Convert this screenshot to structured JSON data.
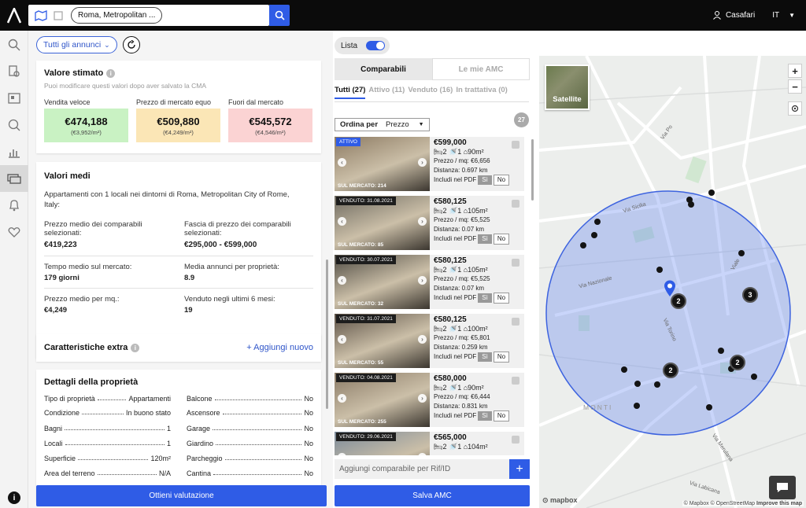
{
  "topbar": {
    "location_chip": "Roma, Metropolitan ...",
    "user_name": "Casafari",
    "language": "IT"
  },
  "left": {
    "filter_dropdown": "Tutti gli annunci",
    "valore": {
      "title": "Valore stimato",
      "hint": "Puoi modificare questi valori dopo aver salvato la CMA",
      "labels": [
        "Vendita veloce",
        "Prezzo di mercato equo",
        "Fuori dal mercato"
      ],
      "values": [
        "€474,188",
        "€509,880",
        "€545,572"
      ],
      "per_m2": [
        "(€3,952/m²)",
        "(€4,249/m²)",
        "(€4,546/m²)"
      ]
    },
    "medi": {
      "title": "Valori medi",
      "desc": "Appartamenti con 1 locali nei dintorni di Roma, Metropolitan City of Rome, Italy:",
      "items": [
        {
          "label": "Prezzo medio dei comparabili selezionati:",
          "value": "€419,223"
        },
        {
          "label": "Fascia di prezzo dei comparabili selezionati:",
          "value": "€295,000 - €599,000"
        },
        {
          "label": "Tempo medio sul mercato:",
          "value": "179 giorni"
        },
        {
          "label": "Media annunci per proprietà:",
          "value": "8.9"
        },
        {
          "label": "Prezzo medio per mq.:",
          "value": "€4,249"
        },
        {
          "label": "Venduto negli ultimi 6 mesi:",
          "value": "19"
        }
      ]
    },
    "extra": {
      "title": "Caratteristiche extra",
      "add": "+ Aggiungi nuovo"
    },
    "dettagli": {
      "title": "Dettagli della proprietà",
      "left_rows": [
        {
          "k": "Tipo di proprietà",
          "v": "Appartamenti"
        },
        {
          "k": "Condizione",
          "v": "In buono stato"
        },
        {
          "k": "Bagni",
          "v": "1"
        },
        {
          "k": "Locali",
          "v": "1"
        },
        {
          "k": "Superficie",
          "v": "120m²"
        },
        {
          "k": "Area del terreno",
          "v": "N/A"
        }
      ],
      "right_rows": [
        {
          "k": "Balcone",
          "v": "No"
        },
        {
          "k": "Ascensore",
          "v": "No"
        },
        {
          "k": "Garage",
          "v": "No"
        },
        {
          "k": "Giardino",
          "v": "No"
        },
        {
          "k": "Parcheggio",
          "v": "No"
        },
        {
          "k": "Cantina",
          "v": "No"
        }
      ]
    },
    "cta": "Ottieni valutazione"
  },
  "middle": {
    "toggle_label": "Lista",
    "tabs": [
      "Comparabili",
      "Le mie AMC"
    ],
    "filters": [
      "Tutti (27)",
      "Attivo (11)",
      "Venduto (16)",
      "In trattativa (0)"
    ],
    "sort_label": "Ordina per",
    "sort_value": "Prezzo",
    "count": "27",
    "listings": [
      {
        "badge": "ATTIVO",
        "mkt": "SUL MERCATO: 214",
        "price": "€599,000",
        "rooms": "2",
        "baths": "1",
        "area": "90m²",
        "ppm": "Prezzo / mq: €6,656",
        "dist": "Distanza: 0.697 km"
      },
      {
        "badge": "VENDUTO: 31.08.2021",
        "mkt": "SUL MERCATO: 85",
        "price": "€580,125",
        "rooms": "2",
        "baths": "1",
        "area": "105m²",
        "ppm": "Prezzo / mq: €5,525",
        "dist": "Distanza: 0.07 km"
      },
      {
        "badge": "VENDUTO: 30.07.2021",
        "mkt": "SUL MERCATO: 32",
        "price": "€580,125",
        "rooms": "2",
        "baths": "1",
        "area": "105m²",
        "ppm": "Prezzo / mq: €5,525",
        "dist": "Distanza: 0.07 km"
      },
      {
        "badge": "VENDUTO: 31.07.2021",
        "mkt": "SUL MERCATO: 55",
        "price": "€580,125",
        "rooms": "2",
        "baths": "1",
        "area": "100m²",
        "ppm": "Prezzo / mq: €5,801",
        "dist": "Distanza: 0.259 km"
      },
      {
        "badge": "VENDUTO: 04.08.2021",
        "mkt": "SUL MERCATO: 255",
        "price": "€580,000",
        "rooms": "2",
        "baths": "1",
        "area": "90m²",
        "ppm": "Prezzo / mq: €6,444",
        "dist": "Distanza: 0.831 km"
      },
      {
        "badge": "VENDUTO: 29.06.2021",
        "mkt": "",
        "price": "€565,000",
        "rooms": "2",
        "baths": "1",
        "area": "104m²",
        "ppm": "",
        "dist": ""
      }
    ],
    "pdf_label": "Includi nel PDF",
    "pdf_yes": "Sì",
    "pdf_no": "No",
    "add_placeholder": "Aggiungi comparabile per Rif/ID",
    "cta": "Salva AMC"
  },
  "map": {
    "satellite": "Satellite",
    "labels": [
      "Via Sicilia",
      "Via Po",
      "Via Torino",
      "MONTI",
      "Via Merulana",
      "Via Labicana",
      "Viale",
      "Via Nazionale"
    ],
    "clusters": [
      "2",
      "3",
      "2",
      "2"
    ],
    "brand": "mapbox",
    "attribution": "© Mapbox © OpenStreetMap",
    "improve": "Improve this map"
  }
}
